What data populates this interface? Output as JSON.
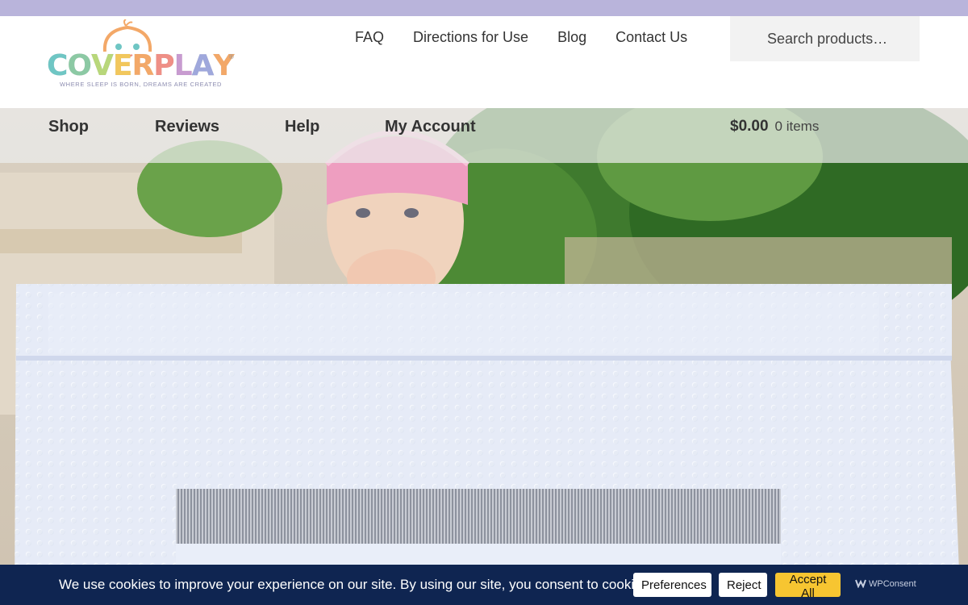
{
  "header": {
    "logo": {
      "wordmark_letters": [
        {
          "ch": "C",
          "color": "#6fc6c4"
        },
        {
          "ch": "O",
          "color": "#8cc9a4"
        },
        {
          "ch": "V",
          "color": "#b8d77a"
        },
        {
          "ch": "E",
          "color": "#f2c75c"
        },
        {
          "ch": "R",
          "color": "#f3a868"
        },
        {
          "ch": "P",
          "color": "#ef8f86"
        },
        {
          "ch": "L",
          "color": "#c89bd0"
        },
        {
          "ch": "A",
          "color": "#9fa8dc"
        },
        {
          "ch": "Y",
          "color": "#f3a868"
        }
      ],
      "wordmark": "COVERPLAY",
      "registered": "®",
      "tagline": "WHERE SLEEP IS BORN, DREAMS ARE CREATED"
    },
    "top_nav": [
      "FAQ",
      "Directions for Use",
      "Blog",
      "Contact Us"
    ],
    "search": {
      "placeholder": "Search products…",
      "value": ""
    }
  },
  "main_nav": {
    "items": [
      "Shop",
      "Reviews",
      "Help",
      "My Account"
    ],
    "cart_amount": "$0.00",
    "cart_items": "0 items"
  },
  "hero": {
    "image": "toddler-in-white-minky-covered-playard-outdoors",
    "colors": {
      "sky": "#e8e2d6",
      "foliage": "#3f7a2e",
      "cover": "#dfe5f5",
      "mesh": "#9aa0ad",
      "hat": "#ee9ec0"
    }
  },
  "cookie_banner": {
    "message": "We use cookies to improve your experience on our site. By using our site, you consent to cookies.",
    "preferences_label": "Preferences",
    "reject_label": "Reject",
    "accept_label": "Accept All",
    "brand": "WPConsent",
    "background_color": "#0f2551",
    "accept_color": "#f7c531"
  },
  "colors": {
    "top_strip": "#b9b4db",
    "nav_text": "#333333"
  }
}
